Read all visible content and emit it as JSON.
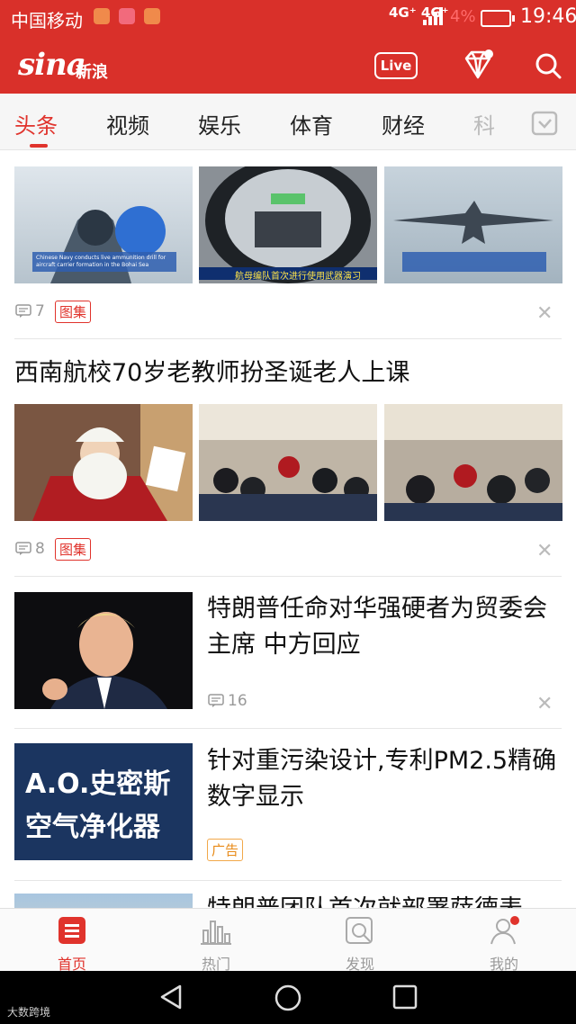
{
  "status": {
    "carrier": "中国移动",
    "network": "4G⁺ 4G⁺",
    "battery": "4%",
    "time": "19:46"
  },
  "header": {
    "logo": "sina",
    "logo_cn": "新浪",
    "live_label": "Live"
  },
  "tabs": [
    "头条",
    "视频",
    "娱乐",
    "体育",
    "财经",
    "科"
  ],
  "feed": {
    "item1": {
      "comments": "7",
      "tag": "图集",
      "caption": "Chinese Navy conducts live ammunition drill for aircraft carrier formation in the Bohai Sea",
      "caption2": "航母编队首次进行使用武器演习"
    },
    "item2": {
      "title": "西南航校70岁老教师扮圣诞老人上课",
      "comments": "8",
      "tag": "图集"
    },
    "item3": {
      "title": "特朗普任命对华强硬者为贸委会主席 中方回应",
      "comments": "16"
    },
    "item4": {
      "title": "针对重污染设计,专利PM2.5精确数字显示",
      "tag": "广告",
      "ad_line1": "A.O.史密斯",
      "ad_line2": "空气净化器"
    },
    "item5": {
      "title": "特朗普团队首次就部署萨德表"
    }
  },
  "bottom_nav": [
    "首页",
    "热门",
    "发现",
    "我的"
  ],
  "watermark": "大数跨境",
  "colors": {
    "brand": "#d9302a",
    "accent": "#e0332c"
  }
}
